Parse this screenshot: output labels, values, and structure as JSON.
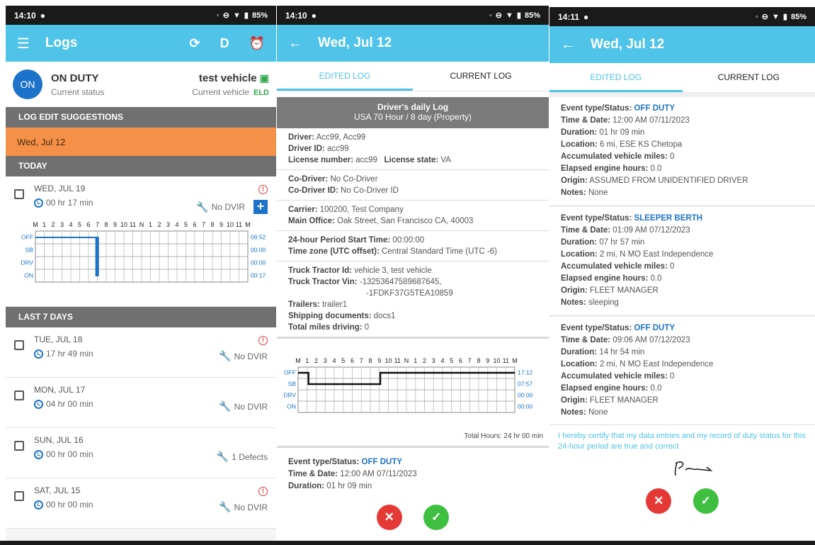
{
  "screen1": {
    "statusbar": {
      "time": "14:10",
      "battery": "85%"
    },
    "appbar": {
      "title": "Logs",
      "d_label": "D"
    },
    "status": {
      "circle": "ON",
      "state": "ON DUTY",
      "state_sub": "Current status",
      "vehicle": "test vehicle",
      "vehicle_sub": "Current vehicle",
      "eld": "ELD"
    },
    "suggestions_header": "LOG EDIT SUGGESTIONS",
    "suggestion_item": "Wed, Jul 12",
    "today_header": "TODAY",
    "today": {
      "date": "WED, JUL 19",
      "duration": "00 hr  17 min",
      "dvir": "No DVIR"
    },
    "grid": {
      "hours": [
        "M",
        "1",
        "2",
        "3",
        "4",
        "5",
        "6",
        "7",
        "8",
        "9",
        "10",
        "11",
        "N",
        "1",
        "2",
        "3",
        "4",
        "5",
        "6",
        "7",
        "8",
        "9",
        "10",
        "11",
        "M"
      ],
      "rows": [
        "OFF",
        "SB",
        "DRV",
        "ON"
      ],
      "totals": [
        "06:52",
        "00:00",
        "00:00",
        "00:17"
      ]
    },
    "last7_header": "LAST 7 DAYS",
    "days": [
      {
        "date": "TUE, JUL 18",
        "duration": "17 hr  49 min",
        "dvir": "No DVIR",
        "warn": true
      },
      {
        "date": "MON, JUL 17",
        "duration": "04 hr  00 min",
        "dvir": "No DVIR",
        "warn": false
      },
      {
        "date": "SUN, JUL 16",
        "duration": "00 hr  00 min",
        "dvir": "1 Defects",
        "warn": false
      },
      {
        "date": "SAT, JUL 15",
        "duration": "00 hr  00 min",
        "dvir": "No DVIR",
        "warn": true
      }
    ]
  },
  "screen2": {
    "statusbar": {
      "time": "14:10",
      "battery": "85%"
    },
    "appbar": {
      "title": "Wed, Jul 12"
    },
    "tabs": {
      "edited": "EDITED LOG",
      "current": "CURRENT LOG"
    },
    "log_head": {
      "line1": "Driver's daily Log",
      "line2": "USA 70 Hour / 8 day (Property)"
    },
    "driver": {
      "name_label": "Driver:",
      "name": "Acc99, Acc99",
      "id_label": "Driver ID:",
      "id": "acc99",
      "license_label": "License number:",
      "license": "acc99",
      "state_label": "License state:",
      "state": "VA"
    },
    "codriver": {
      "name_label": "Co-Driver:",
      "name": "No Co-Driver",
      "id_label": "Co-Driver ID:",
      "id": "No Co-Driver ID"
    },
    "carrier": {
      "label": "Carrier:",
      "value": "100200, Test Company",
      "office_label": "Main Office:",
      "office": "Oak Street, San Francisco CA, 40003"
    },
    "period": {
      "label": "24-hour Period Start Time:",
      "value": "00:00:00",
      "tz_label": "Time zone (UTC offset):",
      "tz": "Central Standard Time (UTC -6)"
    },
    "truck": {
      "id_label": "Truck Tractor Id:",
      "id": "vehicle 3, test vehicle",
      "vin_label": "Truck Tractor Vin:",
      "vin1": "-13253647589687645,",
      "vin2": "-1FDKF37G5TEA10859",
      "trailers_label": "Trailers:",
      "trailers": "trailer1",
      "ship_label": "Shipping documents:",
      "ship": "docs1",
      "miles_label": "Total miles driving:",
      "miles": "0"
    },
    "grid": {
      "totals": [
        "17:12",
        "07:57",
        "00:00",
        "00:00"
      ]
    },
    "total_hours": "Total Hours: 24 hr 00 min",
    "event": {
      "type_label": "Event type/Status:",
      "type": "OFF DUTY",
      "time_label": "Time & Date:",
      "time": "12:00 AM 07/11/2023",
      "dur_label": "Duration:",
      "dur": "01 hr  09 min"
    }
  },
  "screen3": {
    "statusbar": {
      "time": "14:11",
      "battery": "85%"
    },
    "appbar": {
      "title": "Wed, Jul 12"
    },
    "tabs": {
      "edited": "EDITED LOG",
      "current": "CURRENT LOG"
    },
    "labels": {
      "type": "Event type/Status:",
      "time": "Time & Date:",
      "dur": "Duration:",
      "loc": "Location:",
      "miles": "Accumulated vehicle miles:",
      "engine": "Elapsed engine hours:",
      "origin": "Origin:",
      "notes": "Notes:"
    },
    "events": [
      {
        "type": "OFF DUTY",
        "time": "12:00 AM 07/11/2023",
        "dur": "01 hr  09 min",
        "loc": "6 mi, ESE KS Chetopa",
        "miles": "0",
        "engine": "0.0",
        "origin": "ASSUMED FROM UNIDENTIFIED DRIVER",
        "notes": "None"
      },
      {
        "type": "SLEEPER BERTH",
        "time": "01:09 AM 07/12/2023",
        "dur": "07 hr  57 min",
        "loc": "2 mi, N MO East Independence",
        "miles": "0",
        "engine": "0.0",
        "origin": "FLEET MANAGER",
        "notes": "sleeping"
      },
      {
        "type": "OFF DUTY",
        "time": "09:06 AM 07/12/2023",
        "dur": "14 hr  54 min",
        "loc": "2 mi, N MO East Independence",
        "miles": "0",
        "engine": "0.0",
        "origin": "FLEET MANAGER",
        "notes": "None"
      }
    ],
    "certify": "I hereby certify that my data entries and my record of duty status for this 24-hour period are true and correct"
  },
  "colors": {
    "primary": "#4fc3e8",
    "accent_blue": "#1d73c9",
    "orange": "#f59048",
    "red": "#e53935",
    "green": "#3fbf3f"
  }
}
